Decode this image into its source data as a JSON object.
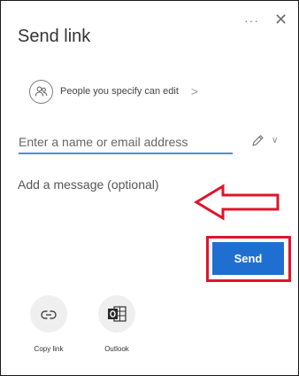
{
  "dialog": {
    "title": "Send link",
    "more_label": "···",
    "close_label": "✕"
  },
  "permission": {
    "text": "People you specify can edit",
    "chevron": ">"
  },
  "recipient": {
    "placeholder": "Enter a name or email address",
    "dropdown_glyph": "∨"
  },
  "message": {
    "placeholder": "Add a message (optional)"
  },
  "send": {
    "label": "Send",
    "highlight_color": "#e0142b"
  },
  "share_options": [
    {
      "label": "Copy link",
      "icon": "link-icon"
    },
    {
      "label": "Outlook",
      "icon": "outlook-icon"
    }
  ],
  "colors": {
    "accent": "#1f6fd1",
    "input_underline": "#4a90d9",
    "annotation_red": "#e0142b"
  }
}
